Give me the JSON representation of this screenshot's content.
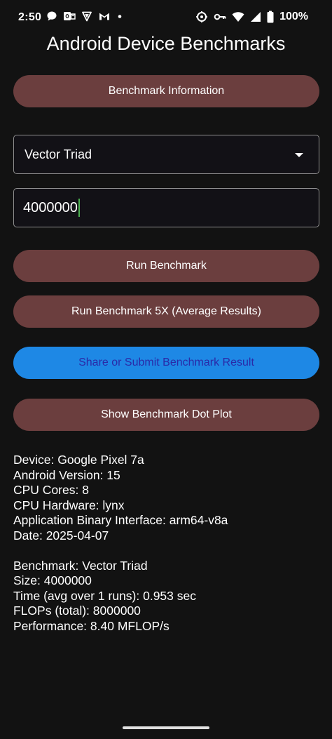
{
  "status_bar": {
    "time": "2:50",
    "battery_percent": "100%",
    "icons_left": [
      "chat-icon",
      "outlook-icon",
      "vpn-shield-icon",
      "gmail-icon",
      "notification-dot-icon"
    ],
    "icons_right": [
      "hotspot-icon",
      "key-icon",
      "wifi-icon",
      "cellular-icon",
      "battery-icon"
    ]
  },
  "app": {
    "title": "Android Device Benchmarks"
  },
  "buttons": {
    "benchmark_info": "Benchmark Information",
    "run": "Run Benchmark",
    "run_5x": "Run Benchmark 5X (Average Results)",
    "share": "Share or Submit Benchmark Result",
    "dot_plot": "Show Benchmark Dot Plot"
  },
  "benchmark_select": {
    "selected": "Vector Triad"
  },
  "size_input": {
    "value": "4000000"
  },
  "device_info": {
    "device": "Device: Google Pixel 7a",
    "android_version": "Android Version: 15",
    "cpu_cores": "CPU Cores: 8",
    "cpu_hardware": "CPU Hardware: lynx",
    "abi": "Application Binary Interface: arm64-v8a",
    "date": "Date: 2025-04-07"
  },
  "result": {
    "benchmark": "Benchmark: Vector Triad",
    "size": "Size: 4000000",
    "time": "Time (avg over 1 runs): 0.953 sec",
    "flops": "FLOPs (total): 8000000",
    "performance": "Performance: 8.40 MFLOP/s"
  },
  "colors": {
    "background": "#121212",
    "pill_button": "#6b3e3e",
    "share_button": "#1e88e5",
    "share_text": "#2a2aa8",
    "caret": "#4caf50"
  }
}
